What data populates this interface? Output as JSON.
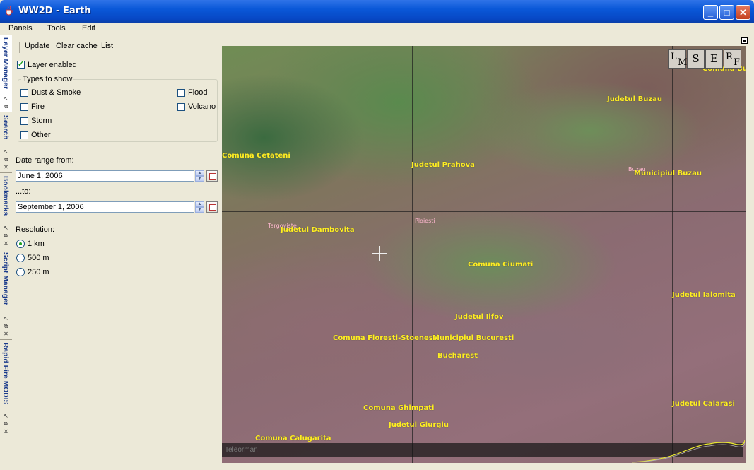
{
  "window": {
    "title": "WW2D - Earth",
    "minimize": "_",
    "maximize": "□",
    "close": "✕"
  },
  "menubar": [
    "Panels",
    "Tools",
    "Edit"
  ],
  "side_tabs": [
    {
      "label": "Layer Manager"
    },
    {
      "label": "Search"
    },
    {
      "label": "Bookmarks"
    },
    {
      "label": "Script Manager"
    },
    {
      "label": "Rapid Fire MODIS"
    }
  ],
  "tab_icons": {
    "pin": "↖",
    "float": "⧉",
    "close": "✕"
  },
  "panel": {
    "toolbar": [
      "Update",
      "Clear cache",
      "List"
    ],
    "layer_enabled": {
      "label": "Layer enabled",
      "checked": true
    },
    "types_group": {
      "title": "Types to show",
      "items": [
        {
          "label": "Dust & Smoke",
          "checked": false
        },
        {
          "label": "Flood",
          "checked": false
        },
        {
          "label": "Fire",
          "checked": false
        },
        {
          "label": "Volcano",
          "checked": false
        },
        {
          "label": "Storm",
          "checked": false
        },
        {
          "label": "Other",
          "checked": false
        }
      ]
    },
    "date_from_label": "Date range from:",
    "date_from_value": "June 1, 2006",
    "date_to_label": "...to:",
    "date_to_value": "September 1, 2006",
    "resolution_label": "Resolution:",
    "resolutions": [
      {
        "label": "1 km",
        "selected": true
      },
      {
        "label": "500 m",
        "selected": false
      },
      {
        "label": "250 m",
        "selected": false
      }
    ]
  },
  "map": {
    "labels": [
      "Comuna Bu",
      "Judetul Buzau",
      "Comuna Cetateni",
      "Judetul Prahova",
      "Buzau",
      "Municipiul Buzau",
      "Targoviste",
      "Ploiesti",
      "Judetul Dambovita",
      "Comuna Ciumati",
      "Judetul Ialomita",
      "Judetul Ilfov",
      "Comuna Floresti-Stoenesti",
      "Municipiul Bucuresti",
      "Bucharest",
      "Comuna Ghimpati",
      "Judetul Giurgiu",
      "Judetul Calarasi",
      "Comuna Calugarita"
    ],
    "nav_buttons": [
      "L",
      "M",
      "S",
      "E",
      "R",
      "F"
    ],
    "status_text": "Teleorman"
  }
}
